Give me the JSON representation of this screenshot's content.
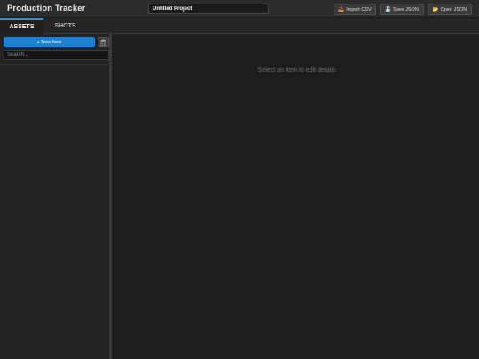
{
  "app": {
    "title": "Production Tracker"
  },
  "project": {
    "name": "Untitled Project"
  },
  "toolbar": {
    "import_label": "Import CSV",
    "save_label": "Save JSON",
    "open_label": "Open JSON",
    "import_icon": "📥",
    "save_icon": "💾",
    "open_icon": "📂"
  },
  "tabs": [
    {
      "label": "ASSETS",
      "active": true
    },
    {
      "label": "SHOTS",
      "active": false
    }
  ],
  "sidebar": {
    "new_item_label": "+ New Item",
    "search_placeholder": "Search...",
    "items": []
  },
  "detail": {
    "empty_message": "Select an item to edit details"
  },
  "colors": {
    "accent": "#1f7fd1",
    "background": "#1e1e1e",
    "panel": "#232323"
  }
}
